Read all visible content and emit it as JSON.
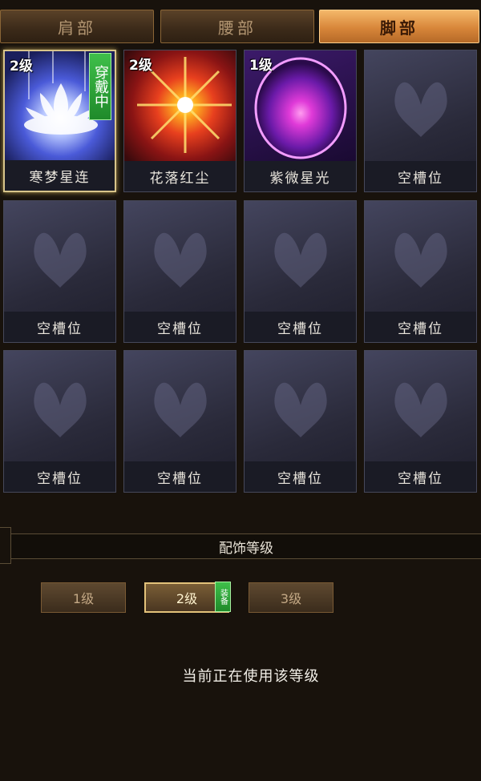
{
  "tabs": [
    {
      "label": "肩部"
    },
    {
      "label": "腰部"
    },
    {
      "label": "脚部"
    }
  ],
  "slots": [
    {
      "name": "寒梦星连",
      "level": "2级",
      "badge": "穿戴中"
    },
    {
      "name": "花落红尘",
      "level": "2级"
    },
    {
      "name": "紫微星光",
      "level": "1级"
    },
    {
      "name": "空槽位"
    },
    {
      "name": "空槽位"
    },
    {
      "name": "空槽位"
    },
    {
      "name": "空槽位"
    },
    {
      "name": "空槽位"
    },
    {
      "name": "空槽位"
    },
    {
      "name": "空槽位"
    },
    {
      "name": "空槽位"
    },
    {
      "name": "空槽位"
    }
  ],
  "panel": {
    "title": "配饰等级",
    "levels": [
      "1级",
      "2级",
      "3级"
    ],
    "equip_badge": "装备",
    "status": "当前正在使用该等级"
  },
  "icons": {
    "slot_1": "white-lotus-icon",
    "slot_2": "red-starburst-icon",
    "slot_3": "purple-orb-icon",
    "empty": "butterfly-placeholder-icon"
  },
  "colors": {
    "active_tab": "#d8863a",
    "equipped_badge": "#2aa63a",
    "background": "#18120c"
  }
}
